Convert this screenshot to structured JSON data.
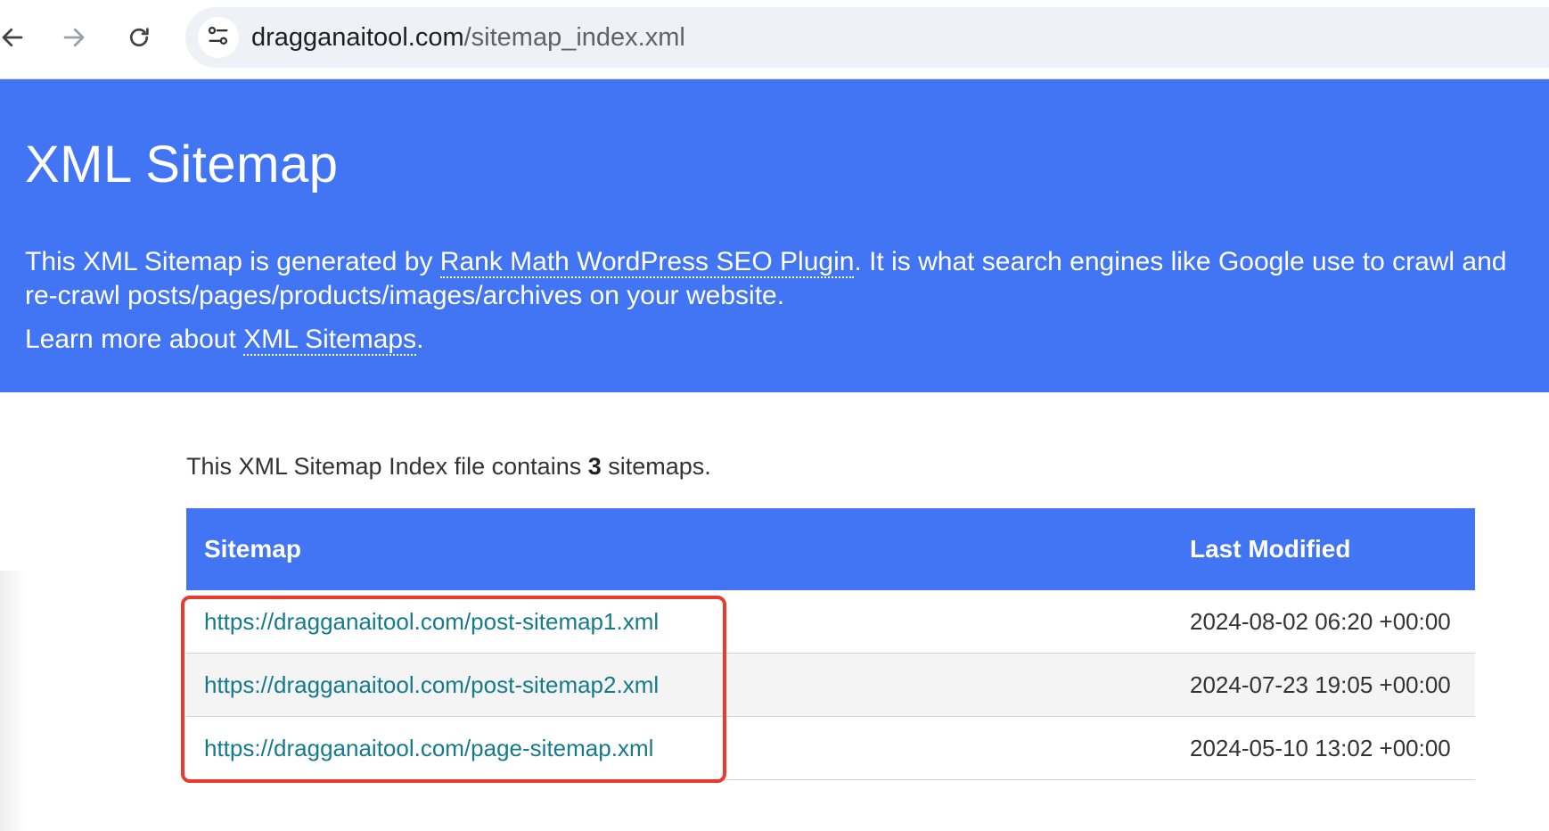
{
  "browser": {
    "url_host": "dragganaitool.com",
    "url_path": "/sitemap_index.xml",
    "icons": {
      "back": "arrow-left-icon",
      "forward": "arrow-right-icon",
      "reload": "reload-icon",
      "site_info": "tune-icon"
    }
  },
  "hero": {
    "title": "XML Sitemap",
    "desc_before": "This XML Sitemap is generated by ",
    "desc_link": "Rank Math WordPress SEO Plugin",
    "desc_after_line1": ". It is what search engines like Google use to crawl and",
    "desc_line2": "re-crawl posts/pages/products/images/archives on your website.",
    "learn_before": "Learn more about ",
    "learn_link": "XML Sitemaps",
    "learn_after": "."
  },
  "summary": {
    "before": "This XML Sitemap Index file contains ",
    "count": "3",
    "after": " sitemaps."
  },
  "table": {
    "headers": [
      "Sitemap",
      "Last Modified"
    ],
    "rows": [
      {
        "url": "https://dragganaitool.com/post-sitemap1.xml",
        "modified": "2024-08-02 06:20 +00:00"
      },
      {
        "url": "https://dragganaitool.com/post-sitemap2.xml",
        "modified": "2024-07-23 19:05 +00:00"
      },
      {
        "url": "https://dragganaitool.com/page-sitemap.xml",
        "modified": "2024-05-10 13:02 +00:00"
      }
    ]
  },
  "colors": {
    "header_blue": "#4275f4",
    "link_teal": "#157a8c",
    "highlight_red": "#e83b2e"
  }
}
